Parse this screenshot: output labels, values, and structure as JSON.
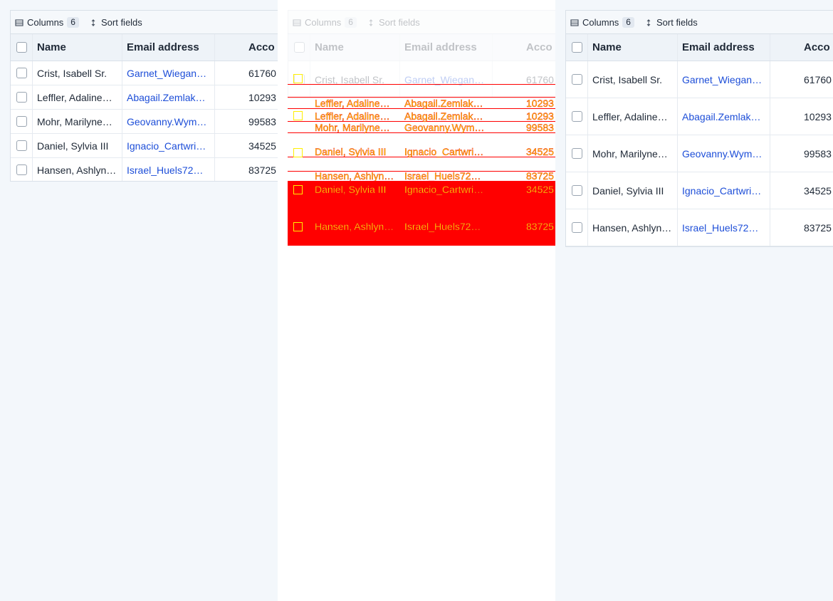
{
  "toolbar": {
    "columns_label": "Columns",
    "columns_count": "6",
    "sort_label": "Sort fields"
  },
  "headers": {
    "name": "Name",
    "email": "Email address",
    "account": "Acco"
  },
  "rows": [
    {
      "name": "Crist, Isabell Sr.",
      "email": "Garnet_Wiegand…",
      "account": "61760"
    },
    {
      "name": "Leffler, Adaline…",
      "email": "Abagail.Zemlak…",
      "account": "10293"
    },
    {
      "name": "Mohr, Marilyne…",
      "email": "Geovanny.Wym…",
      "account": "99583"
    },
    {
      "name": "Daniel, Sylvia III",
      "email": "Ignacio_Cartwri…",
      "account": "34525"
    },
    {
      "name": "Hansen, Ashlyn…",
      "email": "Israel_Huels72…",
      "account": "83725"
    }
  ],
  "colors": {
    "link": "#1d4ed8",
    "overlay_red": "#ff0000",
    "overlay_yellow": "#ffef00"
  }
}
